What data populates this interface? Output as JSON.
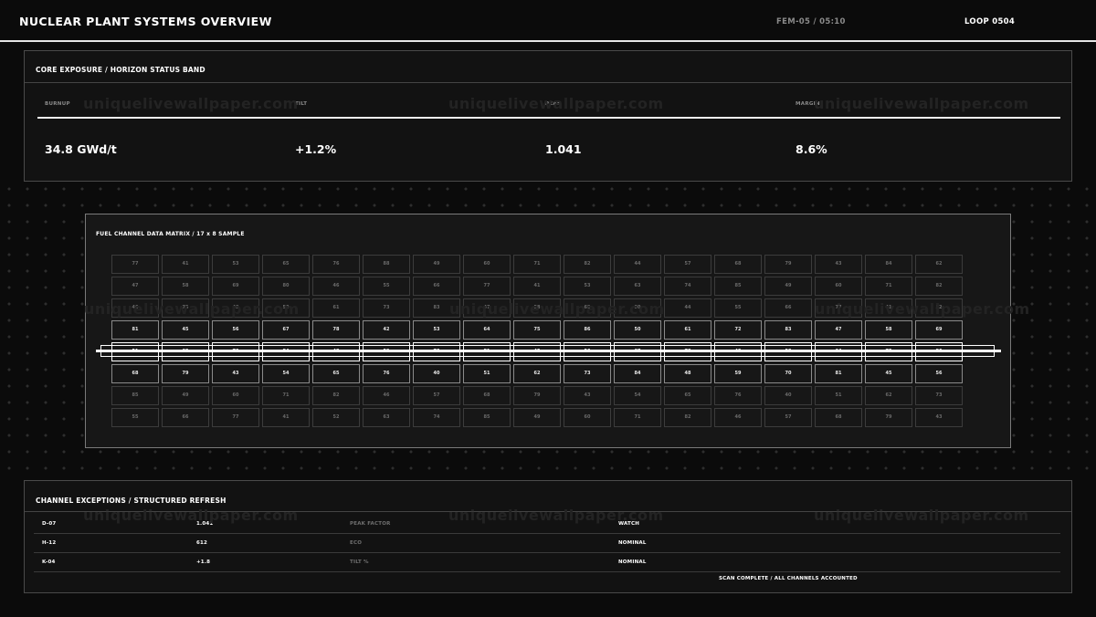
{
  "header": {
    "title": "NUCLEAR PLANT SYSTEMS OVERVIEW",
    "fem": "FEM-05 / 05:10",
    "loop": "LOOP 0504"
  },
  "watermark": "uniquelivewallpaper.com",
  "status": {
    "title": "CORE EXPOSURE / HORIZON STATUS BAND",
    "metrics": [
      {
        "label": "BURNUP",
        "value": "34.8 GWd/t"
      },
      {
        "label": "TILT",
        "value": "+1.2%"
      },
      {
        "label": "PEAK",
        "value": "1.041"
      },
      {
        "label": "MARGIN",
        "value": "8.6%"
      }
    ]
  },
  "matrix": {
    "title": "FUEL CHANNEL DATA MATRIX / 17 x 8 SAMPLE",
    "rows": [
      {
        "style": "dim",
        "cells": [
          "77",
          "41",
          "53",
          "65",
          "76",
          "88",
          "49",
          "60",
          "71",
          "82",
          "44",
          "57",
          "68",
          "79",
          "43",
          "84",
          "62"
        ]
      },
      {
        "style": "dim",
        "cells": [
          "47",
          "58",
          "69",
          "80",
          "46",
          "55",
          "66",
          "77",
          "41",
          "53",
          "63",
          "74",
          "85",
          "49",
          "60",
          "71",
          "82"
        ]
      },
      {
        "style": "dim",
        "cells": [
          "46",
          "75",
          "48",
          "50",
          "61",
          "73",
          "83",
          "47",
          "58",
          "69",
          "80",
          "44",
          "55",
          "66",
          "77",
          "41",
          "52"
        ]
      },
      {
        "style": "bright",
        "cells": [
          "81",
          "45",
          "56",
          "67",
          "78",
          "42",
          "53",
          "64",
          "75",
          "86",
          "50",
          "61",
          "72",
          "83",
          "47",
          "58",
          "69"
        ]
      },
      {
        "style": "focus",
        "cells": [
          "51",
          "62",
          "73",
          "84",
          "48",
          "59",
          "70",
          "81",
          "45",
          "56",
          "67",
          "78",
          "42",
          "53",
          "64",
          "75",
          "86"
        ]
      },
      {
        "style": "bright",
        "cells": [
          "68",
          "79",
          "43",
          "54",
          "65",
          "76",
          "40",
          "51",
          "62",
          "73",
          "84",
          "48",
          "59",
          "70",
          "81",
          "45",
          "56"
        ]
      },
      {
        "style": "dim",
        "cells": [
          "85",
          "49",
          "60",
          "71",
          "82",
          "46",
          "57",
          "68",
          "79",
          "43",
          "54",
          "65",
          "76",
          "40",
          "51",
          "62",
          "73"
        ]
      },
      {
        "style": "dim",
        "cells": [
          "55",
          "66",
          "77",
          "41",
          "52",
          "63",
          "74",
          "85",
          "49",
          "60",
          "71",
          "82",
          "46",
          "57",
          "68",
          "79",
          "43"
        ]
      }
    ]
  },
  "exceptions": {
    "title": "CHANNEL EXCEPTIONS / STRUCTURED REFRESH",
    "rows": [
      {
        "channel": "D-07",
        "value": "1.041",
        "metric": "PEAK FACTOR",
        "status": "WATCH"
      },
      {
        "channel": "H-12",
        "value": "612",
        "metric": "ECO",
        "status": "NOMINAL"
      },
      {
        "channel": "K-04",
        "value": "+1.8",
        "metric": "TILT %",
        "status": "NOMINAL"
      }
    ],
    "footer": "SCAN COMPLETE / ALL CHANNELS ACCOUNTED"
  }
}
